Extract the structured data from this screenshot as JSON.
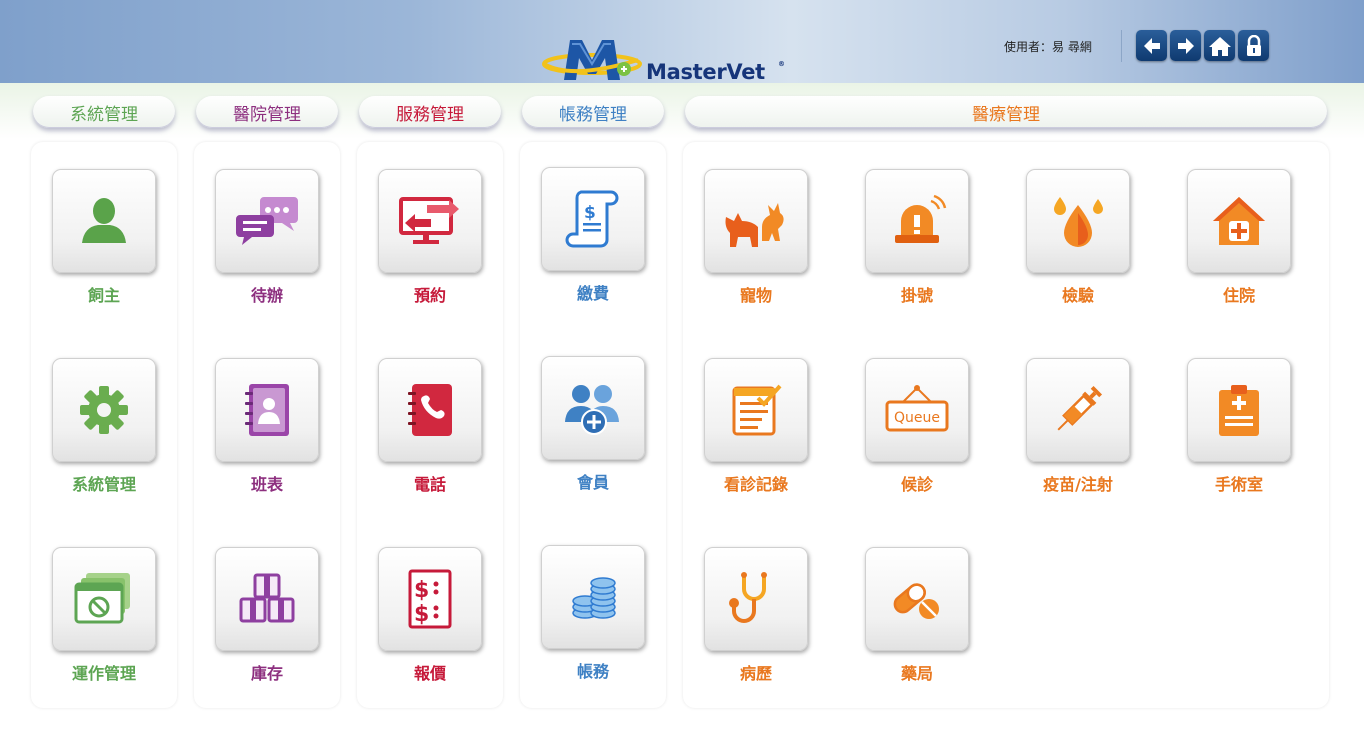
{
  "app": {
    "logo_text": "MasterVet",
    "logo_reg": "®"
  },
  "header": {
    "user_text": "使用者：易 尋網",
    "nav_icons": [
      "back-icon",
      "forward-icon",
      "home-icon",
      "lock-icon"
    ]
  },
  "tabs": [
    "系統管理",
    "醫院管理",
    "服務管理",
    "帳務管理",
    "醫療管理"
  ],
  "tiles": {
    "owner": "飼主",
    "system": "系統管理",
    "operations": "運作管理",
    "todo": "待辦",
    "schedule": "班表",
    "inventory": "庫存",
    "appointment": "預約",
    "phone": "電話",
    "quote": "報價",
    "payment": "繳費",
    "member": "會員",
    "accounts": "帳務",
    "pet": "寵物",
    "registration": "掛號",
    "lab": "檢驗",
    "inpatient": "住院",
    "consult_record": "看診記錄",
    "queue": "候診",
    "vaccine": "疫苗/注射",
    "surgery": "手術室",
    "medical_history": "病歷",
    "pharmacy": "藥局"
  },
  "icon_text": {
    "queue_sign": "Queue"
  },
  "colors": {
    "system": "#5da553",
    "hospital": "#8d2f7f",
    "service": "#c61a3a",
    "finance": "#3f81c4",
    "medical": "#e9781f",
    "nav_button": "#1a4a86",
    "header_blue": "#7fa0cb"
  }
}
